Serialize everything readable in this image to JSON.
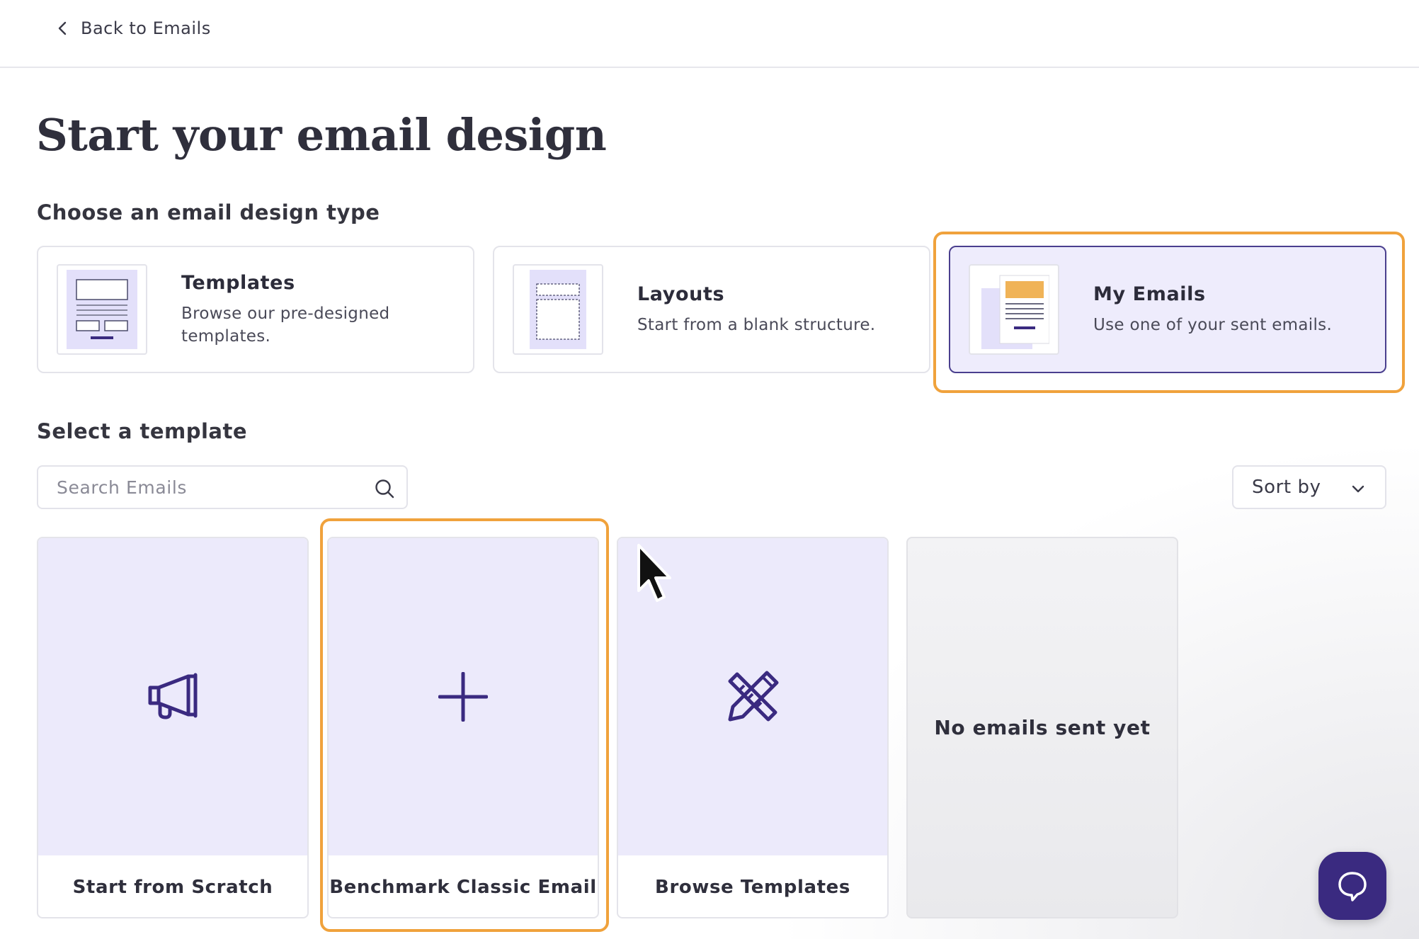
{
  "topbar": {
    "back_label": "Back to Emails"
  },
  "page": {
    "title": "Start your email design"
  },
  "design_type": {
    "heading": "Choose an email design type",
    "options": [
      {
        "name": "Templates",
        "description": "Browse our pre-designed templates.",
        "selected": false
      },
      {
        "name": "Layouts",
        "description": "Start from a blank structure.",
        "selected": false
      },
      {
        "name": "My Emails",
        "description": "Use one of your sent emails.",
        "selected": true
      }
    ]
  },
  "template_section": {
    "heading": "Select a template",
    "search": {
      "placeholder": "Search Emails",
      "value": ""
    },
    "sort": {
      "label": "Sort by"
    },
    "cards": [
      {
        "label": "Start from Scratch",
        "icon": "megaphone-icon"
      },
      {
        "label": "Benchmark Classic Email",
        "icon": "plus-icon"
      },
      {
        "label": "Browse Templates",
        "icon": "pencil-ruler-icon"
      }
    ],
    "empty_message": "No emails sent yet"
  },
  "colors": {
    "accent": "#3a2a80",
    "selection_bg": "#eeecfc",
    "highlight": "#f0a23c",
    "card_preview_bg": "#eceafb"
  }
}
